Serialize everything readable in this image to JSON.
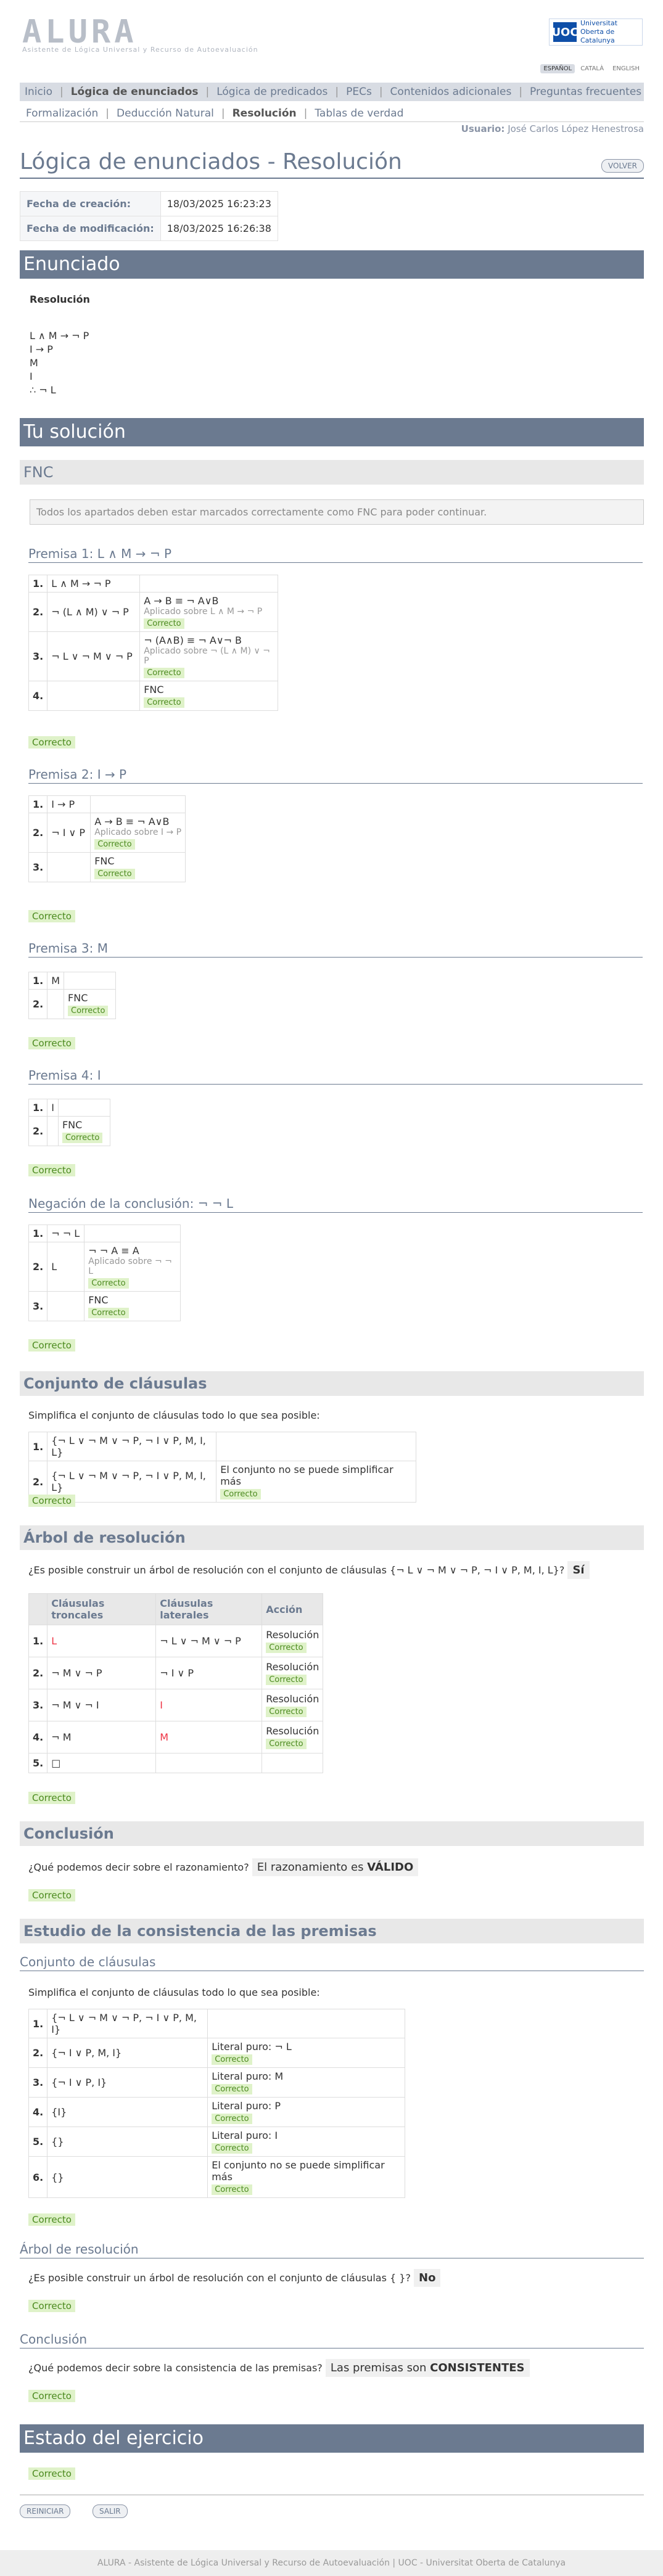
{
  "header": {
    "logo": "ALURA",
    "logo_sub": "Asistente de Lógica Universal y Recurso de Autoevaluación",
    "uoc_mark": "UOC",
    "uoc_text": "Universitat Oberta de Catalunya",
    "langs": [
      "ESPAÑOL",
      "CATALÀ",
      "ENGLISH"
    ]
  },
  "nav": {
    "main": [
      "Inicio",
      "Lógica de enunciados",
      "Lógica de predicados",
      "PECs",
      "Contenidos adicionales",
      "Preguntas frecuentes"
    ],
    "sub": [
      "Formalización",
      "Deducción Natural",
      "Resolución",
      "Tablas de verdad"
    ]
  },
  "user": {
    "label": "Usuario:",
    "name": "José Carlos López Henestrosa"
  },
  "page": {
    "title": "Lógica de enunciados - Resolución",
    "volver": "VOLVER",
    "creation_label": "Fecha de creación:",
    "creation_value": "18/03/2025 16:23:23",
    "mod_label": "Fecha de modificación:",
    "mod_value": "18/03/2025 16:26:38"
  },
  "enunciado": {
    "title": "Enunciado",
    "subtitle": "Resolución",
    "lines": [
      "L ∧ M → ¬ P",
      "I → P",
      "M",
      "I",
      "∴ ¬ L"
    ]
  },
  "solucion": {
    "title": "Tu solución",
    "fnc_title": "FNC",
    "fnc_info": "Todos los apartados deben estar marcados correctamente como FNC para poder continuar.",
    "correcto": "Correcto"
  },
  "premisas": [
    {
      "title": "Premisa 1: L ∧ M → ¬ P",
      "rows": [
        {
          "n": "1.",
          "f": "L ∧ M → ¬ P",
          "rule": "",
          "note": "",
          "badge": false
        },
        {
          "n": "2.",
          "f": "¬ (L ∧ M) ∨ ¬ P",
          "rule": "A → B ≡ ¬ A∨B",
          "note": "Aplicado sobre L ∧ M → ¬ P",
          "badge": true
        },
        {
          "n": "3.",
          "f": "¬ L ∨ ¬ M ∨ ¬ P",
          "rule": "¬ (A∧B) ≡ ¬ A∨¬ B",
          "note": "Aplicado sobre ¬ (L ∧ M) ∨ ¬ P",
          "badge": true
        },
        {
          "n": "4.",
          "f": "",
          "rule": "FNC",
          "note": "",
          "badge": true
        }
      ]
    },
    {
      "title": "Premisa 2: I → P",
      "rows": [
        {
          "n": "1.",
          "f": "I → P",
          "rule": "",
          "note": "",
          "badge": false
        },
        {
          "n": "2.",
          "f": "¬ I ∨ P",
          "rule": "A → B ≡ ¬ A∨B",
          "note": "Aplicado sobre I → P",
          "badge": true
        },
        {
          "n": "3.",
          "f": "",
          "rule": "FNC",
          "note": "",
          "badge": true
        }
      ]
    },
    {
      "title": "Premisa 3: M",
      "rows": [
        {
          "n": "1.",
          "f": "M",
          "rule": "",
          "note": "",
          "badge": false
        },
        {
          "n": "2.",
          "f": "",
          "rule": "FNC",
          "note": "",
          "badge": true
        }
      ]
    },
    {
      "title": "Premisa 4: I",
      "rows": [
        {
          "n": "1.",
          "f": "I",
          "rule": "",
          "note": "",
          "badge": false
        },
        {
          "n": "2.",
          "f": "",
          "rule": "FNC",
          "note": "",
          "badge": true
        }
      ]
    },
    {
      "title": "Negación de la conclusión: ¬ ¬ L",
      "rows": [
        {
          "n": "1.",
          "f": "¬ ¬ L",
          "rule": "",
          "note": "",
          "badge": false
        },
        {
          "n": "2.",
          "f": "L",
          "rule": "¬ ¬ A ≡ A",
          "note": "Aplicado sobre ¬ ¬ L",
          "badge": true
        },
        {
          "n": "3.",
          "f": "",
          "rule": "FNC",
          "note": "",
          "badge": true
        }
      ]
    }
  ],
  "clausulas": {
    "title": "Conjunto de cláusulas",
    "intro": "Simplifica el conjunto de cláusulas todo lo que sea posible:",
    "rows": [
      {
        "n": "1.",
        "f": "{¬ L ∨ ¬ M ∨ ¬ P, ¬ I ∨ P, M, I, L}",
        "res": "",
        "badge": false
      },
      {
        "n": "2.",
        "f": "{¬ L ∨ ¬ M ∨ ¬ P, ¬ I ∨ P, M, I, L}",
        "res": "El conjunto no se puede simplificar más",
        "badge": true
      }
    ]
  },
  "arbol": {
    "title": "Árbol de resolución",
    "question": "¿Es posible construir un árbol de resolución con el conjunto de cláusulas {¬ L ∨ ¬ M ∨ ¬ P, ¬ I ∨ P, M, I, L}?",
    "answer": "Sí",
    "headers": [
      "Cláusulas troncales",
      "Cláusulas laterales",
      "Acción"
    ],
    "rows": [
      {
        "n": "1.",
        "t": "L",
        "l": "¬ L ∨ ¬ M ∨ ¬ P",
        "a": "Resolución",
        "badge": true
      },
      {
        "n": "2.",
        "t": "¬ M ∨ ¬ P",
        "l": "¬ I ∨ P",
        "a": "Resolución",
        "badge": true
      },
      {
        "n": "3.",
        "t": "¬ M ∨ ¬ I",
        "l": "I",
        "a": "Resolución",
        "badge": true
      },
      {
        "n": "4.",
        "t": "¬ M",
        "l": "M",
        "a": "Resolución",
        "badge": true
      },
      {
        "n": "5.",
        "t": "□",
        "l": "",
        "a": "",
        "badge": false
      }
    ]
  },
  "conclusion": {
    "title": "Conclusión",
    "question": "¿Qué podemos decir sobre el razonamiento?",
    "answer_pre": "El razonamiento es",
    "answer_bold": "VÁLIDO"
  },
  "consistencia": {
    "title": "Estudio de la consistencia de las premisas",
    "sub_clausulas": "Conjunto de cláusulas",
    "intro": "Simplifica el conjunto de cláusulas todo lo que sea posible:",
    "rows": [
      {
        "n": "1.",
        "f": "{¬ L ∨ ¬ M ∨ ¬ P, ¬ I ∨ P, M, I}",
        "res": "",
        "badge": false
      },
      {
        "n": "2.",
        "f": "{¬ I ∨ P, M, I}",
        "res": "Literal puro: ¬ L",
        "badge": true
      },
      {
        "n": "3.",
        "f": "{¬ I ∨ P, I}",
        "res": "Literal puro: M",
        "badge": true
      },
      {
        "n": "4.",
        "f": "{I}",
        "res": "Literal puro: P",
        "badge": true
      },
      {
        "n": "5.",
        "f": "{}",
        "res": "Literal puro: I",
        "badge": true
      },
      {
        "n": "6.",
        "f": "{}",
        "res": "El conjunto no se puede simplificar más",
        "badge": true
      }
    ],
    "sub_arbol": "Árbol de resolución",
    "arbol_q": "¿Es posible construir un árbol de resolución con el conjunto de cláusulas { }?",
    "arbol_a": "No",
    "sub_conclusion": "Conclusión",
    "concl_q": "¿Qué podemos decir sobre la consistencia de las premisas?",
    "concl_pre": "Las premisas son",
    "concl_bold": "CONSISTENTES"
  },
  "estado": {
    "title": "Estado del ejercicio"
  },
  "actions": {
    "reiniciar": "REINICIAR",
    "salir": "SALIR"
  },
  "footer": "ALURA - Asistente de Lógica Universal y Recurso de Autoevaluación | UOC - Universitat Oberta de Catalunya"
}
